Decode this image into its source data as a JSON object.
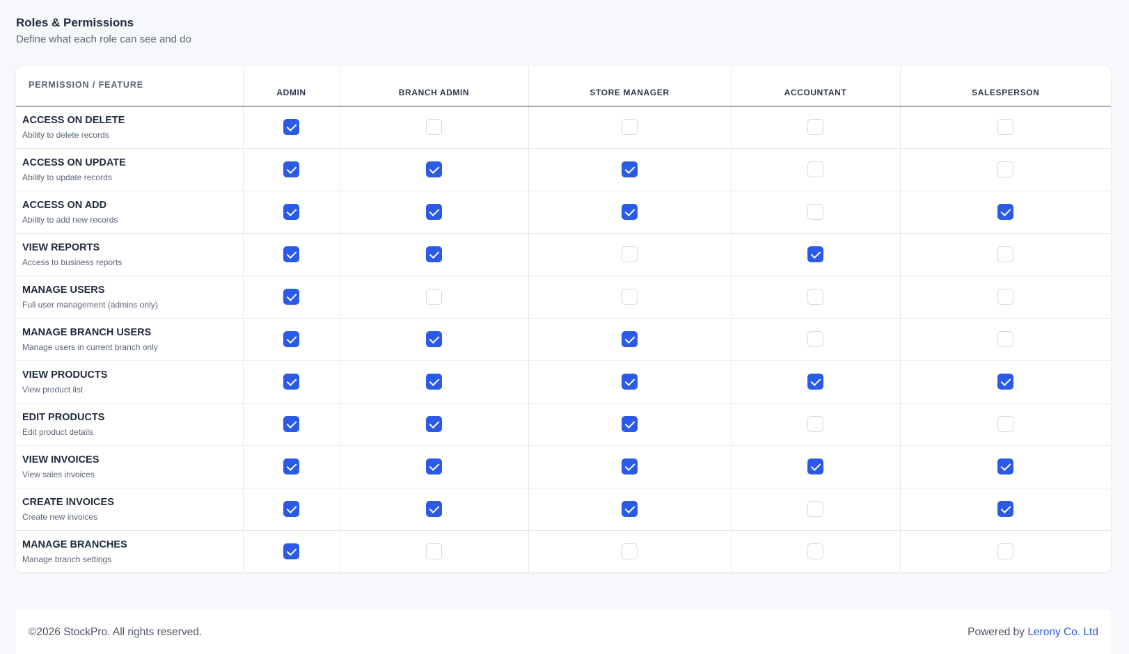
{
  "header": {
    "title": "Roles & Permissions",
    "subtitle": "Define what each role can see and do"
  },
  "table": {
    "feature_column_label": "PERMISSION / FEATURE",
    "roles": [
      "ADMIN",
      "BRANCH ADMIN",
      "STORE MANAGER",
      "ACCOUNTANT",
      "SALESPERSON"
    ],
    "permissions": [
      {
        "name": "ACCESS ON DELETE",
        "description": "Ability to delete records",
        "checked": [
          true,
          false,
          false,
          false,
          false
        ]
      },
      {
        "name": "ACCESS ON UPDATE",
        "description": "Ability to update records",
        "checked": [
          true,
          true,
          true,
          false,
          false
        ]
      },
      {
        "name": "ACCESS ON ADD",
        "description": "Ability to add new records",
        "checked": [
          true,
          true,
          true,
          false,
          true
        ]
      },
      {
        "name": "VIEW REPORTS",
        "description": "Access to business reports",
        "checked": [
          true,
          true,
          false,
          true,
          false
        ]
      },
      {
        "name": "MANAGE USERS",
        "description": "Full user management (admins only)",
        "checked": [
          true,
          false,
          false,
          false,
          false
        ]
      },
      {
        "name": "MANAGE BRANCH USERS",
        "description": "Manage users in current branch only",
        "checked": [
          true,
          true,
          true,
          false,
          false
        ]
      },
      {
        "name": "VIEW PRODUCTS",
        "description": "View product list",
        "checked": [
          true,
          true,
          true,
          true,
          true
        ]
      },
      {
        "name": "EDIT PRODUCTS",
        "description": "Edit product details",
        "checked": [
          true,
          true,
          true,
          false,
          false
        ]
      },
      {
        "name": "VIEW INVOICES",
        "description": "View sales invoices",
        "checked": [
          true,
          true,
          true,
          true,
          true
        ]
      },
      {
        "name": "CREATE INVOICES",
        "description": "Create new invoices",
        "checked": [
          true,
          true,
          true,
          false,
          true
        ]
      },
      {
        "name": "MANAGE BRANCHES",
        "description": "Manage branch settings",
        "checked": [
          true,
          false,
          false,
          false,
          false
        ]
      }
    ]
  },
  "footer": {
    "copyright": "©2026 StockPro. All rights reserved.",
    "powered_prefix": "Powered by ",
    "powered_link": "Lerony Co. Ltd"
  },
  "colors": {
    "accent": "#2b5ae7",
    "background": "#f6f8fb",
    "text_primary": "#1f2a3c",
    "text_secondary": "#5b6576"
  }
}
